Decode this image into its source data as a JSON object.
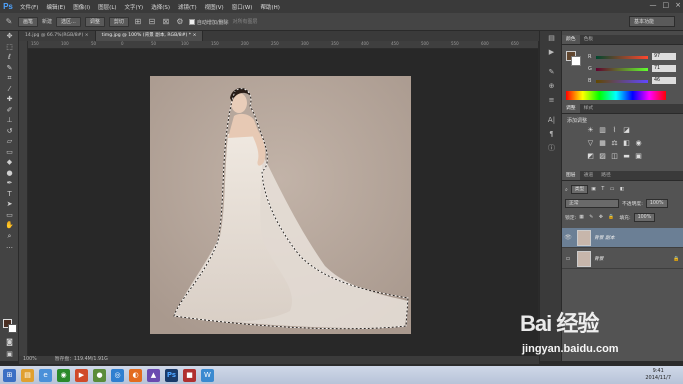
{
  "app": {
    "logo": "Ps"
  },
  "menu": [
    "文件(F)",
    "编辑(E)",
    "图像(I)",
    "图层(L)",
    "文字(Y)",
    "选择(S)",
    "滤镜(T)",
    "视图(V)",
    "窗口(W)",
    "帮助(H)"
  ],
  "window_controls": [
    "—",
    "□",
    "×"
  ],
  "options": {
    "mode_select": "画笔",
    "new_label": "新建",
    "select_btn": "选区...",
    "sub_btn": "调整",
    "edge_btn": "剪切",
    "auto_enhance_label": "自动增加/删除",
    "refine_label": "对所有图层",
    "workspace": "基本功能"
  },
  "tabs": [
    {
      "label": "14.jpg @ 66.7%(RGB/8#) ×",
      "active": false
    },
    {
      "label": "timg.jpg @ 100% (背景 副本, RGB/8#) * ×",
      "active": true
    }
  ],
  "ruler": [
    "150",
    "100",
    "50",
    "0",
    "50",
    "100",
    "150",
    "200",
    "250",
    "300",
    "350",
    "400",
    "450",
    "500",
    "550",
    "600",
    "650"
  ],
  "status": {
    "zoom": "100%",
    "doc": "暂存盘：119.4M/1.91G"
  },
  "color_panel": {
    "tabs": [
      "颜色",
      "色板"
    ],
    "R": "97",
    "G": "71",
    "B": "46",
    "fg_color": "#614730"
  },
  "adjustments_panel": {
    "tabs": [
      "调整",
      "样式"
    ],
    "title": "添加调整",
    "icons": [
      "brightness-icon",
      "levels-icon",
      "curves-icon",
      "exposure-icon",
      "vibrance-icon",
      "hue-icon",
      "colorbalance-icon",
      "bw-icon",
      "photofilter-icon",
      "channelmixer-icon",
      "invert-icon",
      "posterize-icon",
      "threshold-icon",
      "gradientmap-icon",
      "selectivecolor-icon"
    ]
  },
  "layers_panel": {
    "tabs": [
      "图层",
      "通道",
      "路径"
    ],
    "filter": "类型",
    "blend_mode": "正常",
    "opacity_label": "不透明度:",
    "opacity": "100%",
    "lock_label": "锁定:",
    "fill_label": "填充:",
    "fill": "100%",
    "layers": [
      {
        "name": "背景 副本",
        "selected": true,
        "visible": true
      },
      {
        "name": "背景",
        "selected": false,
        "visible": false
      }
    ]
  },
  "taskbar": {
    "time": "9:41",
    "date": "2014/11/7"
  },
  "watermark": {
    "logo": "Bai 经验",
    "url": "jingyan.baidu.com"
  }
}
